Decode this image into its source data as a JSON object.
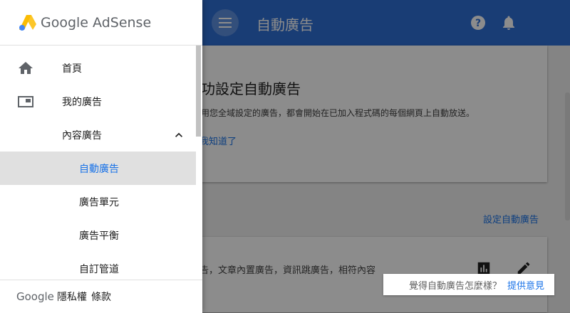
{
  "appbar": {
    "title": "自動廣告"
  },
  "main": {
    "card1": {
      "title": "功設定自動廣告",
      "body": "用您全域設定的廣告，都會開始在已加入程式碼的每個網頁上自動放送。",
      "link": "我知道了"
    },
    "setup_link": "設定自動廣告",
    "card2": {
      "text": "告，文章內置廣告，資訊跳廣告，相符內容"
    },
    "feedback": {
      "question": "覺得自動廣告怎麼樣？",
      "link": "提供意見"
    }
  },
  "drawer": {
    "logo_text": "Google AdSense",
    "items": [
      {
        "label": "首頁",
        "icon": "home-icon"
      },
      {
        "label": "我的廣告",
        "icon": "ad-unit-icon"
      },
      {
        "label": "內容廣告",
        "icon": "chevron-up-icon"
      },
      {
        "label": "自動廣告"
      },
      {
        "label": "廣告單元"
      },
      {
        "label": "廣告平衡"
      },
      {
        "label": "自訂管道"
      }
    ],
    "footer": {
      "google": "Google",
      "privacy": "隱私權",
      "terms": "條款"
    }
  },
  "colors": {
    "appbar": "#2f6fd6",
    "accent": "#1a73e8",
    "active_bg": "#e0e0e0"
  }
}
